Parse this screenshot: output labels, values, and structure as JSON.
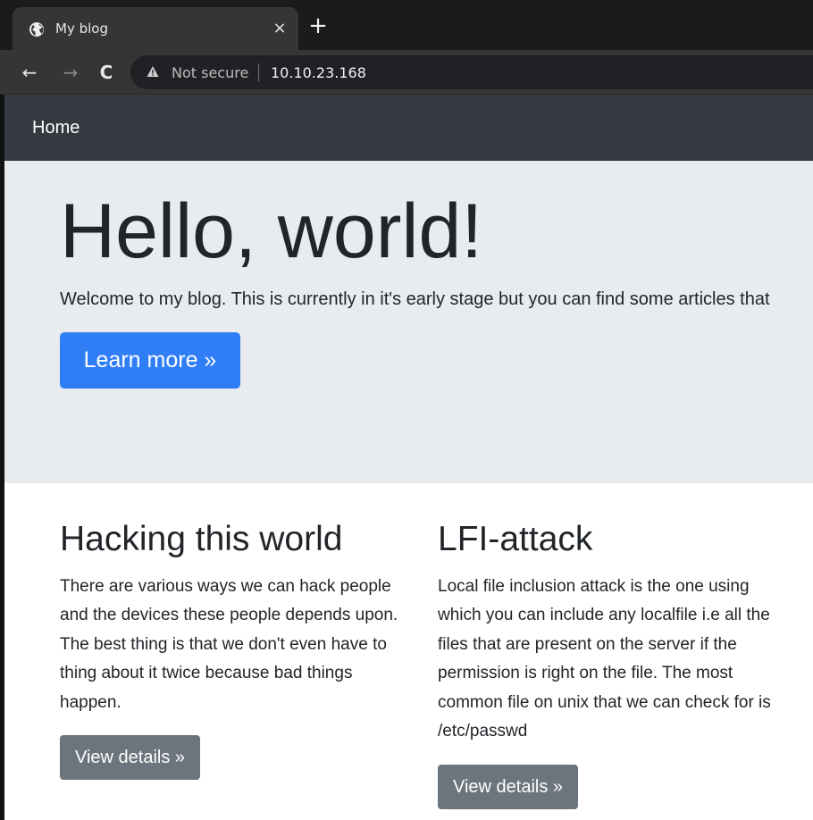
{
  "browser": {
    "tab_title": "My blog",
    "tab_close": "×",
    "new_tab": "+",
    "back": "←",
    "forward": "→",
    "reload": "C",
    "security_label": "Not secure",
    "url": "10.10.23.168"
  },
  "site": {
    "nav_home": "Home",
    "hero": {
      "title": "Hello, world!",
      "lead": "Welcome to my blog. This is currently in it's early stage but you can find some articles that",
      "button": "Learn more »"
    },
    "articles": [
      {
        "title": "Hacking this world",
        "body": "There are various ways we can hack people and the devices these people depends upon. The best thing is that we don't even have to thing about it twice because bad things happen.",
        "button": "View details »"
      },
      {
        "title": "LFI-attack",
        "body": "Local file inclusion attack is the one using which you can include any localfile i.e all the files that are present on the server if the permission is right on the file. The most common file on unix that we can check for is /etc/passwd",
        "button": "View details »"
      }
    ]
  },
  "colors": {
    "navbar": "#343a40",
    "jumbotron": "#e9ecef",
    "primary_button": "#2f7ef6",
    "secondary_button": "#6c757d"
  },
  "icons": {
    "favicon": "globe-icon",
    "security": "warning-triangle-icon"
  }
}
